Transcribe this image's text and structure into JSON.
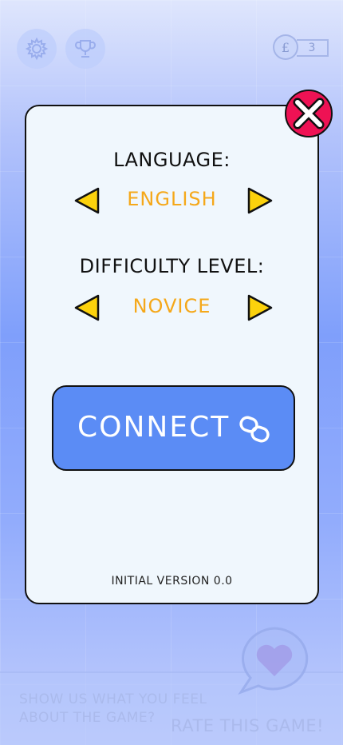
{
  "hud": {
    "settings_icon": "gear-icon",
    "trophy_icon": "trophy-icon",
    "coin_symbol": "£",
    "coin_count": "3"
  },
  "modal": {
    "language_label": "LANGUAGE:",
    "language_value": "ENGLISH",
    "difficulty_label": "DIFFICULTY LEVEL:",
    "difficulty_value": "NOVICE",
    "connect_label": "CONNECT",
    "version": "INITIAL VERSION 0.0"
  },
  "rate_banner": {
    "text": "SHOW US WHAT YOU FEEL ABOUT THE GAME?",
    "title": "RATE THIS GAME!"
  },
  "colors": {
    "accent_blue": "#5b8cf5",
    "value_orange": "#f5a81a",
    "arrow_yellow": "#fcd20c",
    "close_red": "#ee1254",
    "panel_bg": "#f0f7fd"
  }
}
